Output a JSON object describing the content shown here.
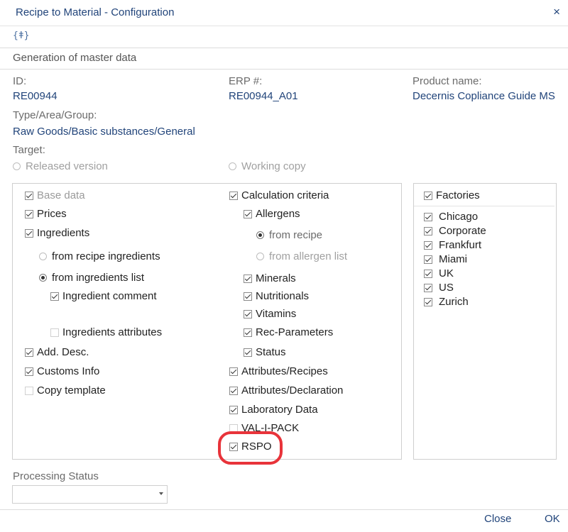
{
  "window": {
    "title": "Recipe to Material - Configuration",
    "close_icon": "×"
  },
  "toolbar": {
    "icon_text": "{ǂ}"
  },
  "section": {
    "title": "Generation of master data"
  },
  "fields": {
    "id": {
      "label": "ID:",
      "value": "RE00944"
    },
    "erp": {
      "label": "ERP #:",
      "value": "RE00944_A01"
    },
    "product": {
      "label": "Product name:",
      "value": "Decernis Copliance Guide MS"
    },
    "type": {
      "label": "Type/Area/Group:",
      "value": "Raw Goods/Basic substances/General"
    },
    "target": {
      "label": "Target:"
    }
  },
  "target_options": {
    "released": "Released version",
    "working": "Working copy"
  },
  "left_column": {
    "base_data": "Base data",
    "prices": "Prices",
    "ingredients": "Ingredients",
    "from_recipe_ingredients": "from recipe ingredients",
    "from_ingredients_list": "from ingredients list",
    "ingredient_comment": "Ingredient comment",
    "ingredients_attributes": "Ingredients attributes",
    "add_desc": "Add. Desc.",
    "customs_info": "Customs Info",
    "copy_template": "Copy template"
  },
  "right_column": {
    "calculation_criteria": "Calculation criteria",
    "allergens": "Allergens",
    "from_recipe": "from recipe",
    "from_allergen_list": "from allergen list",
    "minerals": "Minerals",
    "nutritionals": "Nutritionals",
    "vitamins": "Vitamins",
    "rec_parameters": "Rec-Parameters",
    "status": "Status",
    "attributes_recipes": "Attributes/Recipes",
    "attributes_declaration": "Attributes/Declaration",
    "laboratory_data": "Laboratory Data",
    "val_i_pack": "VAL-I-PACK",
    "rspo": "RSPO"
  },
  "factories": {
    "header": "Factories",
    "items": [
      "Chicago",
      "Corporate",
      "Frankfurt",
      "Miami",
      "UK",
      "US",
      "Zurich"
    ]
  },
  "processing": {
    "label": "Processing Status",
    "value": ""
  },
  "footer": {
    "close": "Close",
    "ok": "OK"
  },
  "colors": {
    "accent": "#21447a",
    "highlight": "#e8333a"
  }
}
